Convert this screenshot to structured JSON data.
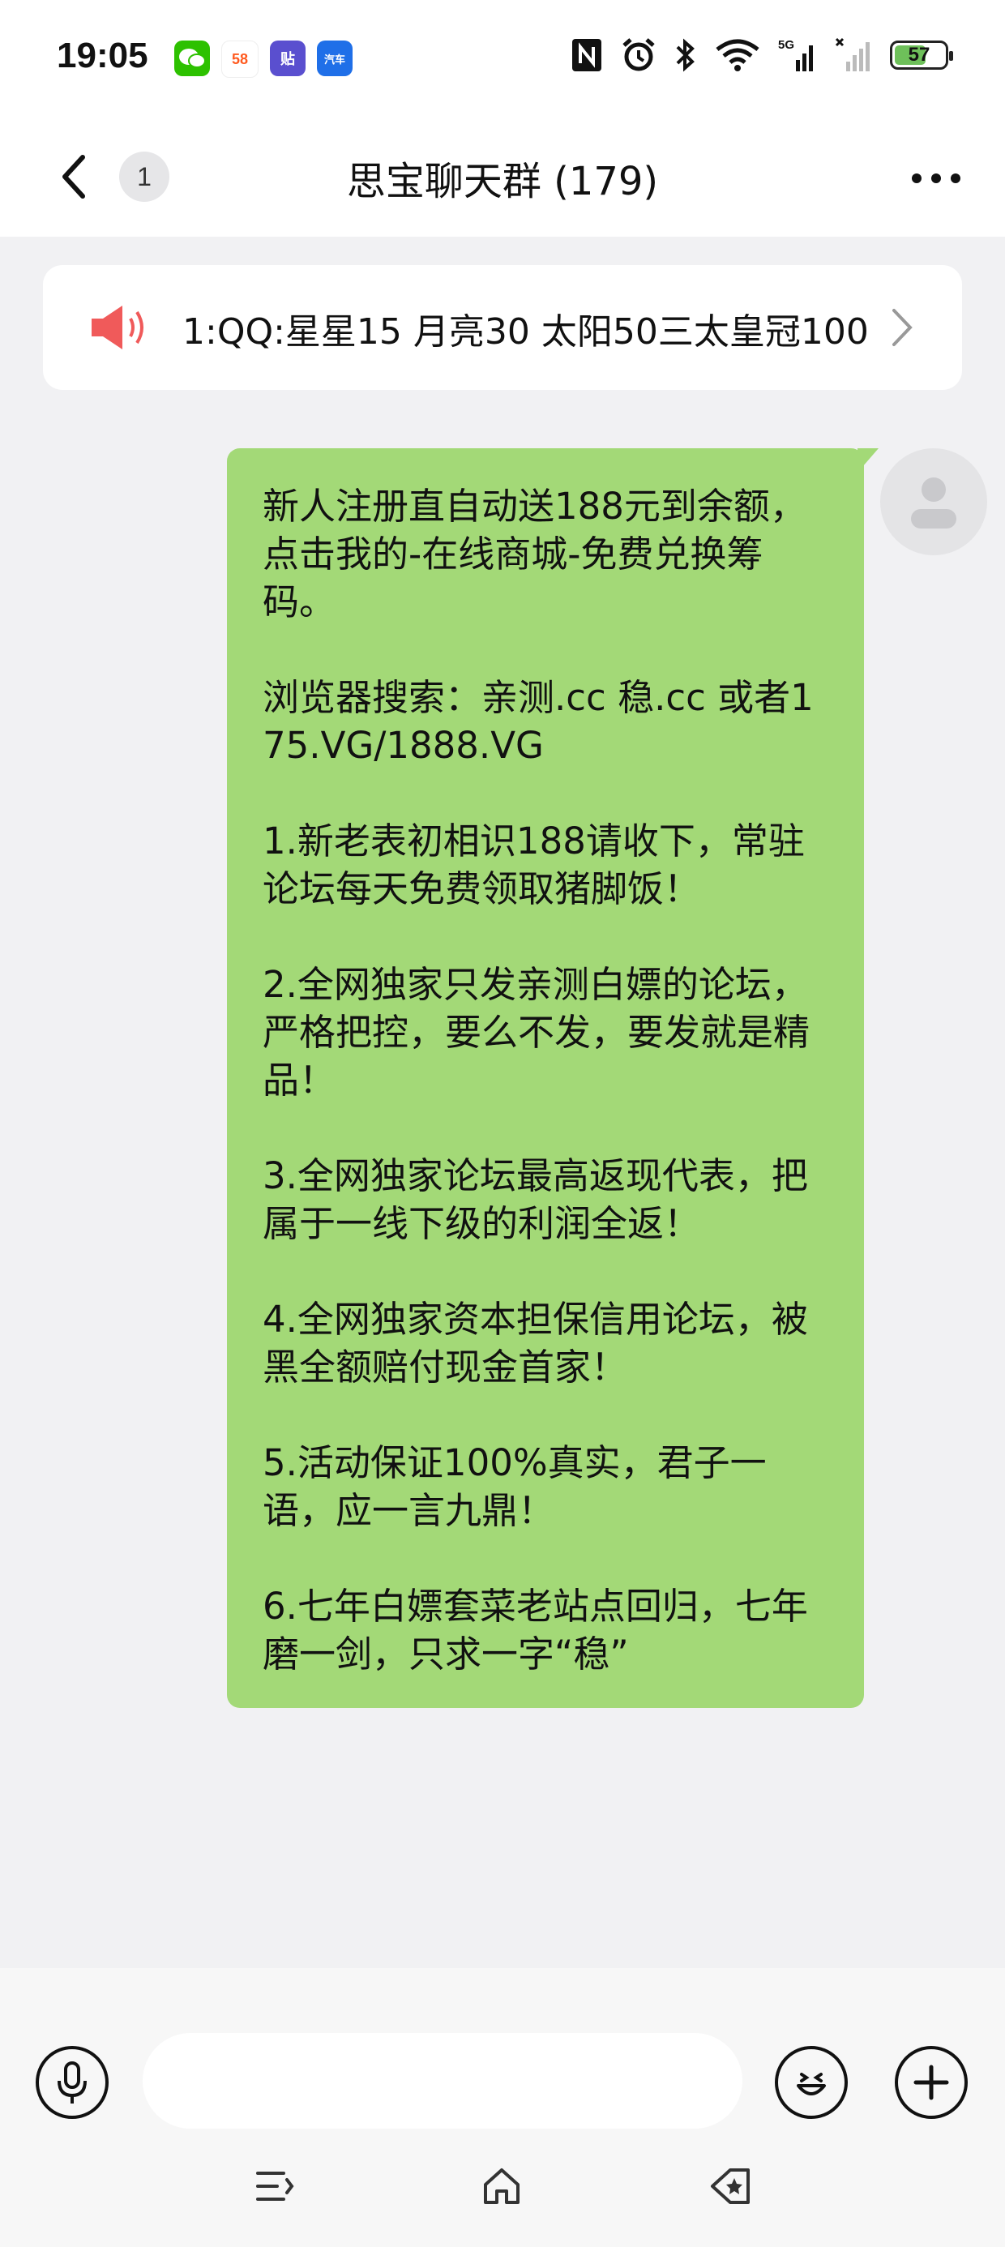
{
  "status_bar": {
    "time": "19:05",
    "notifications": [
      {
        "name": "wechat-icon",
        "label": "",
        "color": "#2dc100"
      },
      {
        "name": "58-app-icon",
        "label": "58",
        "color": "#ff5a1f"
      },
      {
        "name": "tieba-app-icon",
        "label": "贴",
        "color": "#5a4fcf"
      },
      {
        "name": "autohome-app-icon",
        "label": "汽车",
        "color": "#1f6fe8"
      }
    ],
    "battery": "57",
    "network": "5G"
  },
  "header": {
    "unread_count": "1",
    "title": "思宝聊天群 (179)"
  },
  "announcement": {
    "text": "1:QQ:星星15 月亮30 太阳50三太皇冠100"
  },
  "message": {
    "text": "新人注册直自动送188元到余额，点击我的-在线商城-免费兑换筹码。\n\n浏览器搜索：亲测.cc 稳.cc 或者175.VG/1888.VG\n\n1.新老表初相识188请收下，常驻论坛每天免费领取猪脚饭！\n\n2.全网独家只发亲测白嫖的论坛，严格把控，要么不发，要发就是精品！\n\n3.全网独家论坛最高返现代表，把属于一线下级的利润全返！\n\n4.全网独家资本担保信用论坛，被黑全额赔付现金首家！\n\n5.活动保证100%真实，君子一语，应一言九鼎！\n\n6.七年白嫖套菜老站点回归，七年磨一剑，只求一字“稳”",
    "bubble_color": "#a3d977"
  },
  "input": {
    "placeholder": "",
    "value": ""
  },
  "colors": {
    "speaker": "#f05a5a",
    "background": "#f1f1f3"
  }
}
